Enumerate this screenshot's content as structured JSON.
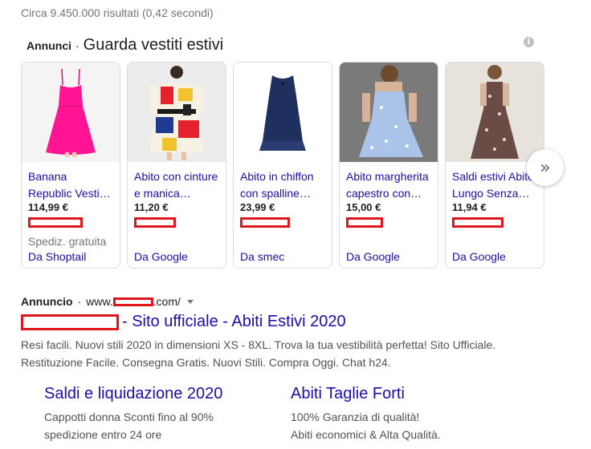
{
  "stats": "Circa 9.450.000 risultati (0,42 secondi)",
  "shopping": {
    "label": "Annunci",
    "separator": "·",
    "title": "Guarda vestiti estivi",
    "info_icon": "info-icon",
    "next_icon": "chevron-right-icon",
    "next_glyph": "»",
    "products": [
      {
        "title_1": "Banana",
        "title_2": "Republic Vesti…",
        "price": "114,99 €",
        "shipping": "Spediz. gratuita",
        "seller": "Da Shoptail",
        "dress_color": "#ff1493"
      },
      {
        "title_1": "Abito con cinture",
        "title_2": "e manica…",
        "price": "11,20 €",
        "shipping": "",
        "seller": "Da Google",
        "dress_color": "#f2c12e"
      },
      {
        "title_1": "Abito in chiffon",
        "title_2": "con spalline…",
        "price": "23,99 €",
        "shipping": "",
        "seller": "Da smec",
        "dress_color": "#1f2f5e"
      },
      {
        "title_1": "Abito margherita",
        "title_2": "capestro con…",
        "price": "15,00 €",
        "shipping": "",
        "seller": "Da Google",
        "dress_color": "#a9c4e8"
      },
      {
        "title_1": "Saldi estivi Abito",
        "title_2": "Lungo Senza…",
        "price": "11,94 €",
        "shipping": "",
        "seller": "Da Google",
        "dress_color": "#6b4b45"
      }
    ]
  },
  "text_ad": {
    "label": "Annuncio",
    "separator": "·",
    "url_prefix": "www.",
    "url_suffix": ".com/",
    "title_suffix": "- Sito ufficiale - Abiti Estivi 2020",
    "description_1": "Resi facili. Nuovi stili 2020 in dimensioni XS - 8XL. Trova la tua vestibilità perfetta! Sito Ufficiale.",
    "description_2": "Restituzione Facile. Consegna Gratis. Nuovi Stili. Compra Oggi. Chat h24.",
    "sitelinks": [
      {
        "title": "Saldi e liquidazione 2020",
        "line_1": "Cappotti donna Sconti fino al 90%",
        "line_2": "spedizione entro 24 ore"
      },
      {
        "title": "Abiti Taglie Forti",
        "line_1": "100% Garanzia di qualità!",
        "line_2": "Abiti economici & Alta Qualità."
      }
    ]
  },
  "colors": {
    "link": "#1a0dab",
    "redaction": "#e0161e",
    "muted": "#70757a"
  }
}
